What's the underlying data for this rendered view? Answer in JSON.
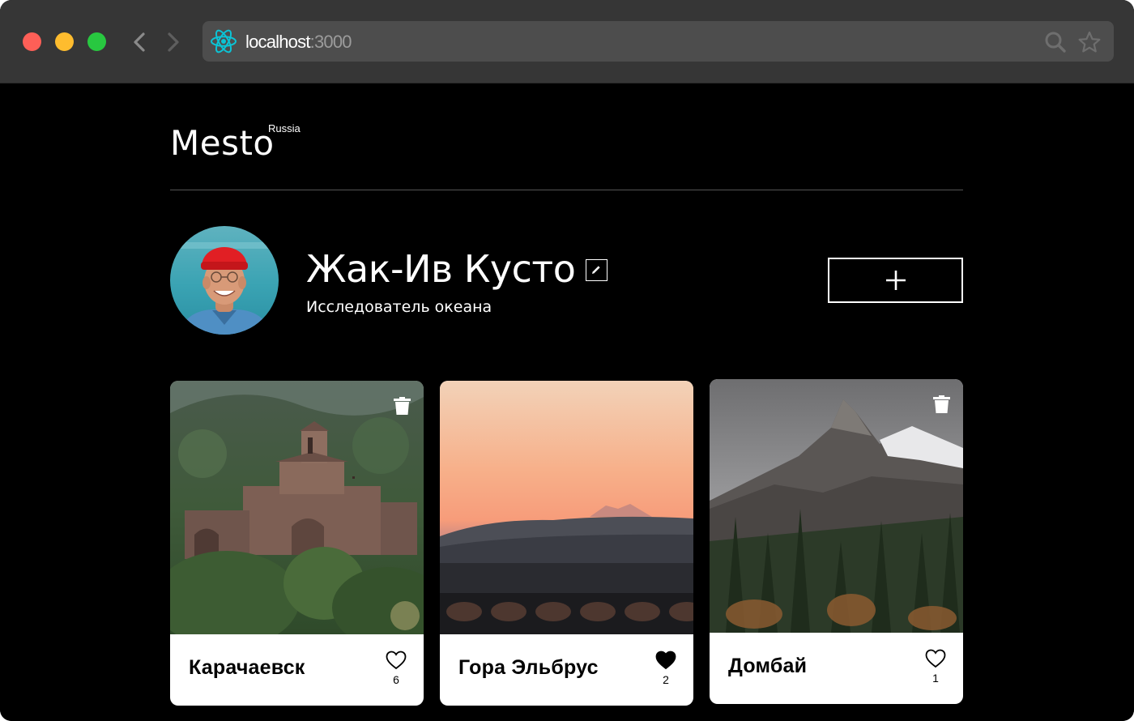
{
  "browser": {
    "url_host": "localhost",
    "url_port": ":3000"
  },
  "header": {
    "logo": "Mesto",
    "logo_superscript": "Russia"
  },
  "profile": {
    "name": "Жак-Ив Кусто",
    "about": "Исследователь океана"
  },
  "cards": [
    {
      "title": "Карачаевск",
      "likes": "6",
      "liked": false,
      "deletable": true
    },
    {
      "title": "Гора Эльбрус",
      "likes": "2",
      "liked": true,
      "deletable": false
    },
    {
      "title": "Домбай",
      "likes": "1",
      "liked": false,
      "deletable": true
    }
  ],
  "icons": {
    "url_icon": "react-logo-icon",
    "search": "search-icon",
    "bookmark": "star-icon",
    "edit": "pencil-icon",
    "add": "plus-icon",
    "like": "heart-icon",
    "delete": "trash-icon"
  },
  "colors": {
    "page_background": "#000000",
    "chrome_background": "#363636",
    "urlbar_background": "#4d4d4d",
    "card_background": "#ffffff",
    "react_accent": "#0bc4d6",
    "traffic_red": "#fe5f57",
    "traffic_yellow": "#febc2e",
    "traffic_green": "#28c840"
  }
}
